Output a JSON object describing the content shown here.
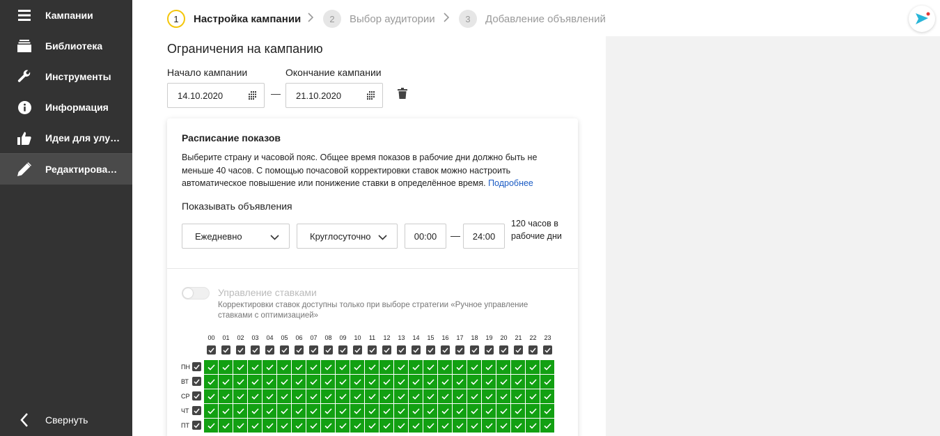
{
  "sidebar": {
    "items": [
      {
        "label": "Кампании",
        "icon": "list-icon"
      },
      {
        "label": "Библиотека",
        "icon": "stack-icon"
      },
      {
        "label": "Инструменты",
        "icon": "wrench-icon"
      },
      {
        "label": "Информация",
        "icon": "info-icon"
      },
      {
        "label": "Идеи для улучшения",
        "icon": "thumbs-up-icon"
      },
      {
        "label": "Редактирование",
        "icon": "pencil-icon",
        "active": true
      }
    ],
    "collapse_label": "Свернуть"
  },
  "stepper": {
    "steps": [
      {
        "num": "1",
        "label": "Настройка кампании",
        "active": true
      },
      {
        "num": "2",
        "label": "Выбор аудитории",
        "active": false
      },
      {
        "num": "3",
        "label": "Добавление объявлений",
        "active": false
      }
    ]
  },
  "campaign_limits": {
    "title": "Ограничения на кампанию",
    "start_label": "Начало кампании",
    "start_value": "14.10.2020",
    "end_label": "Окончание кампании",
    "end_value": "21.10.2020",
    "dash": "—"
  },
  "schedule": {
    "title": "Расписание показов",
    "description": "Выберите страну и часовой пояс. Общее время показов в рабочие дни должно быть не меньше 40 часов. С помощью почасовой корректировки ставок можно настроить автоматическое повышение или понижение ставки в определённое время. ",
    "more_link": "Подробнее",
    "show_label": "Показывать объявления",
    "frequency": "Ежедневно",
    "mode": "Круглосуточно",
    "time_from": "00:00",
    "time_to": "24:00",
    "dash": "—",
    "hours_info": "120 часов в рабочие дни",
    "bid_title": "Управление ставками",
    "bid_note": "Корректировки ставок доступны только при выборе стратегии «Ручное управление ставками с оптимизацией»",
    "bid_enabled": false,
    "hours": [
      "00",
      "01",
      "02",
      "03",
      "04",
      "05",
      "06",
      "07",
      "08",
      "09",
      "10",
      "11",
      "12",
      "13",
      "14",
      "15",
      "16",
      "17",
      "18",
      "19",
      "20",
      "21",
      "22",
      "23"
    ],
    "days": [
      "ПН",
      "ВТ",
      "СР",
      "ЧТ",
      "ПТ"
    ],
    "cell_color": "#12a012"
  }
}
